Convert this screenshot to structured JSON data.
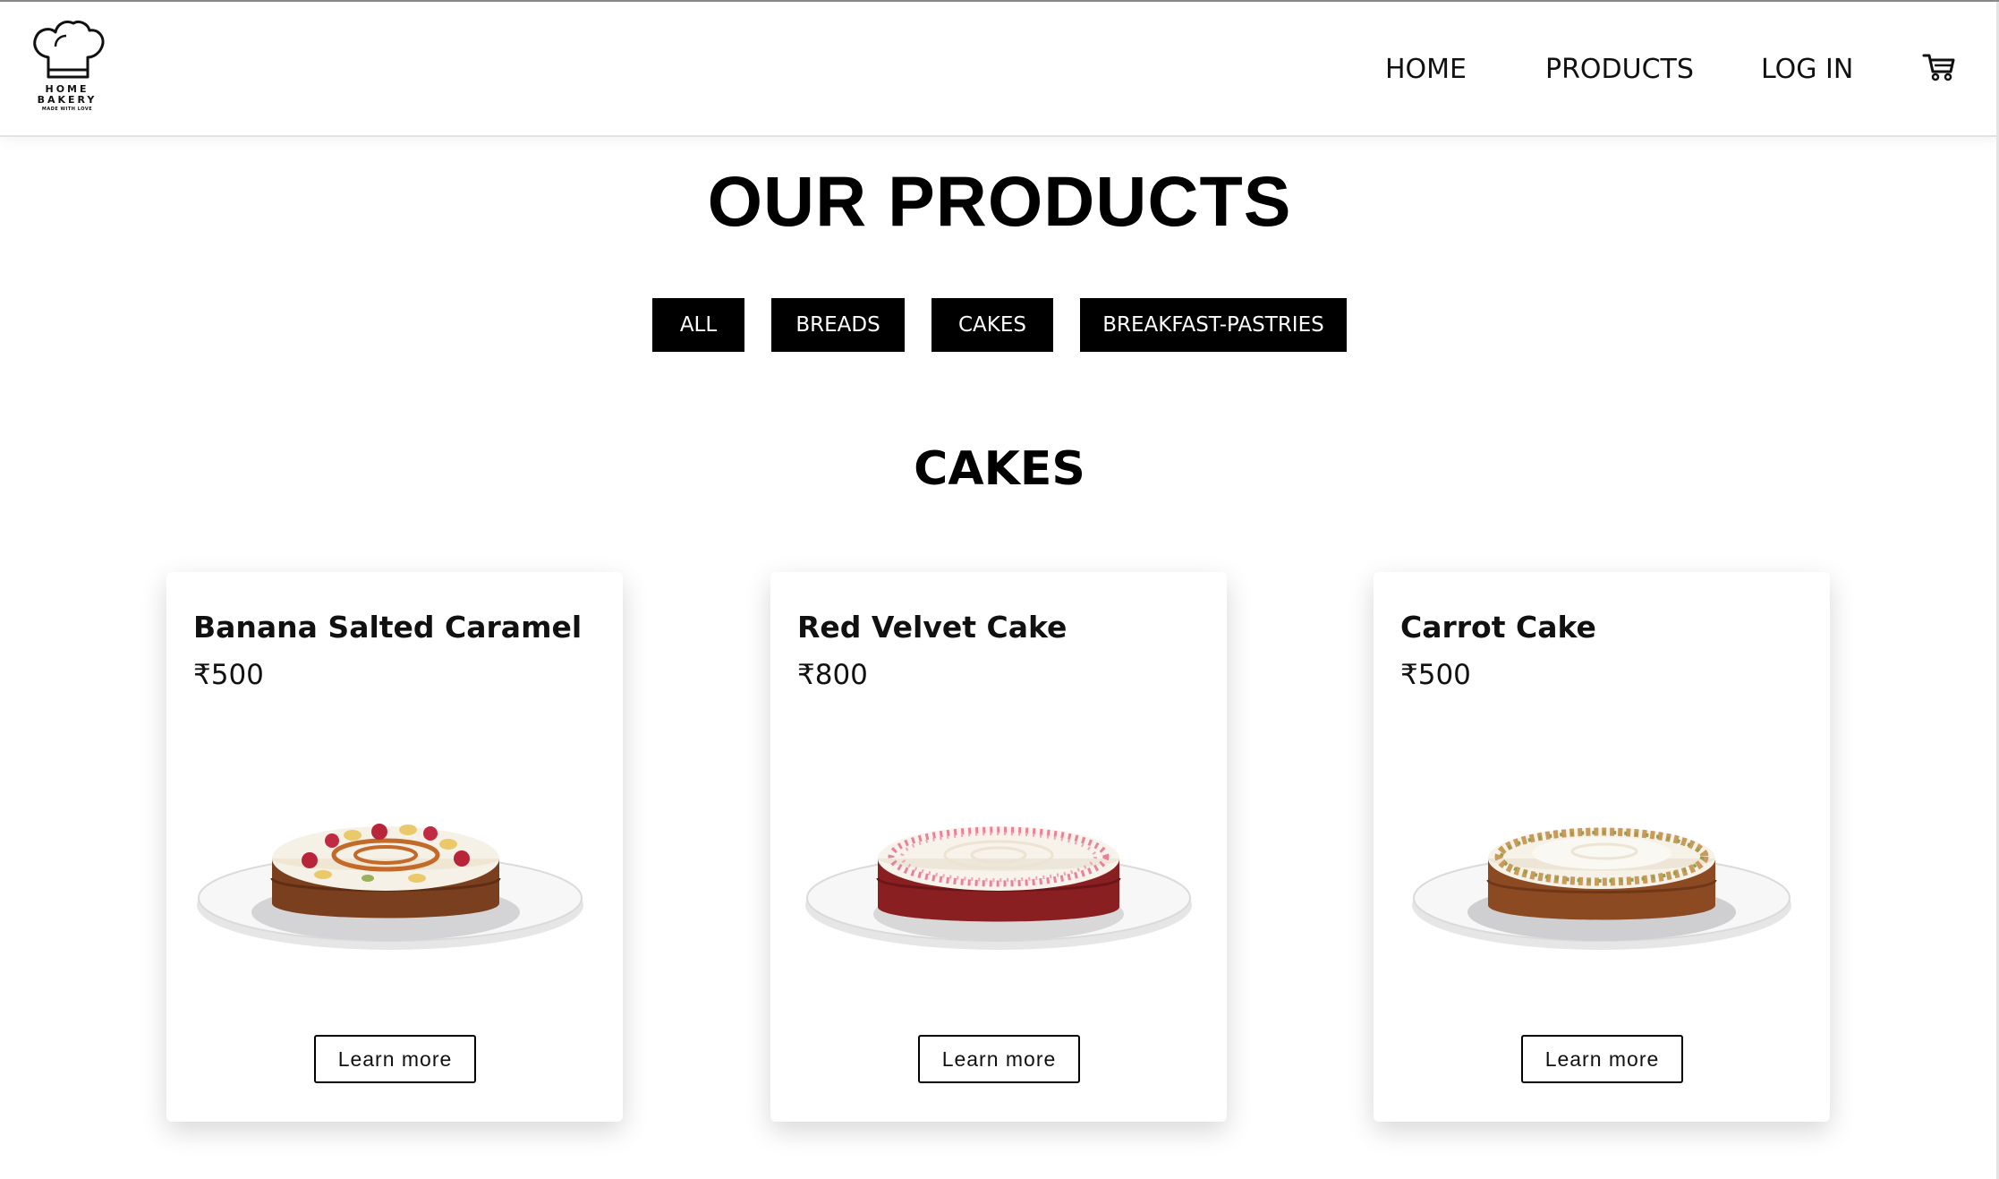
{
  "brand": {
    "logo_line1": "HOME",
    "logo_line2": "BAKERY",
    "logo_tagline": "MADE WITH LOVE"
  },
  "nav": {
    "items": [
      {
        "label": "HOME"
      },
      {
        "label": "PRODUCTS"
      },
      {
        "label": "LOG IN"
      }
    ],
    "cart_icon": "cart-icon"
  },
  "page": {
    "title": "OUR PRODUCTS"
  },
  "filters": [
    {
      "label": "ALL"
    },
    {
      "label": "BREADS"
    },
    {
      "label": "CAKES"
    },
    {
      "label": "BREAKFAST-PASTRIES"
    }
  ],
  "section": {
    "title": "CAKES"
  },
  "products": [
    {
      "name": "Banana Salted Caramel",
      "price": "₹500",
      "button": "Learn more",
      "image": "banana-salted-caramel-cake"
    },
    {
      "name": "Red Velvet Cake",
      "price": "₹800",
      "button": "Learn more",
      "image": "red-velvet-cake"
    },
    {
      "name": "Carrot Cake",
      "price": "₹500",
      "button": "Learn more",
      "image": "carrot-cake"
    }
  ],
  "colors": {
    "button_bg": "#000000",
    "button_text": "#ffffff",
    "background": "#ffffff"
  }
}
